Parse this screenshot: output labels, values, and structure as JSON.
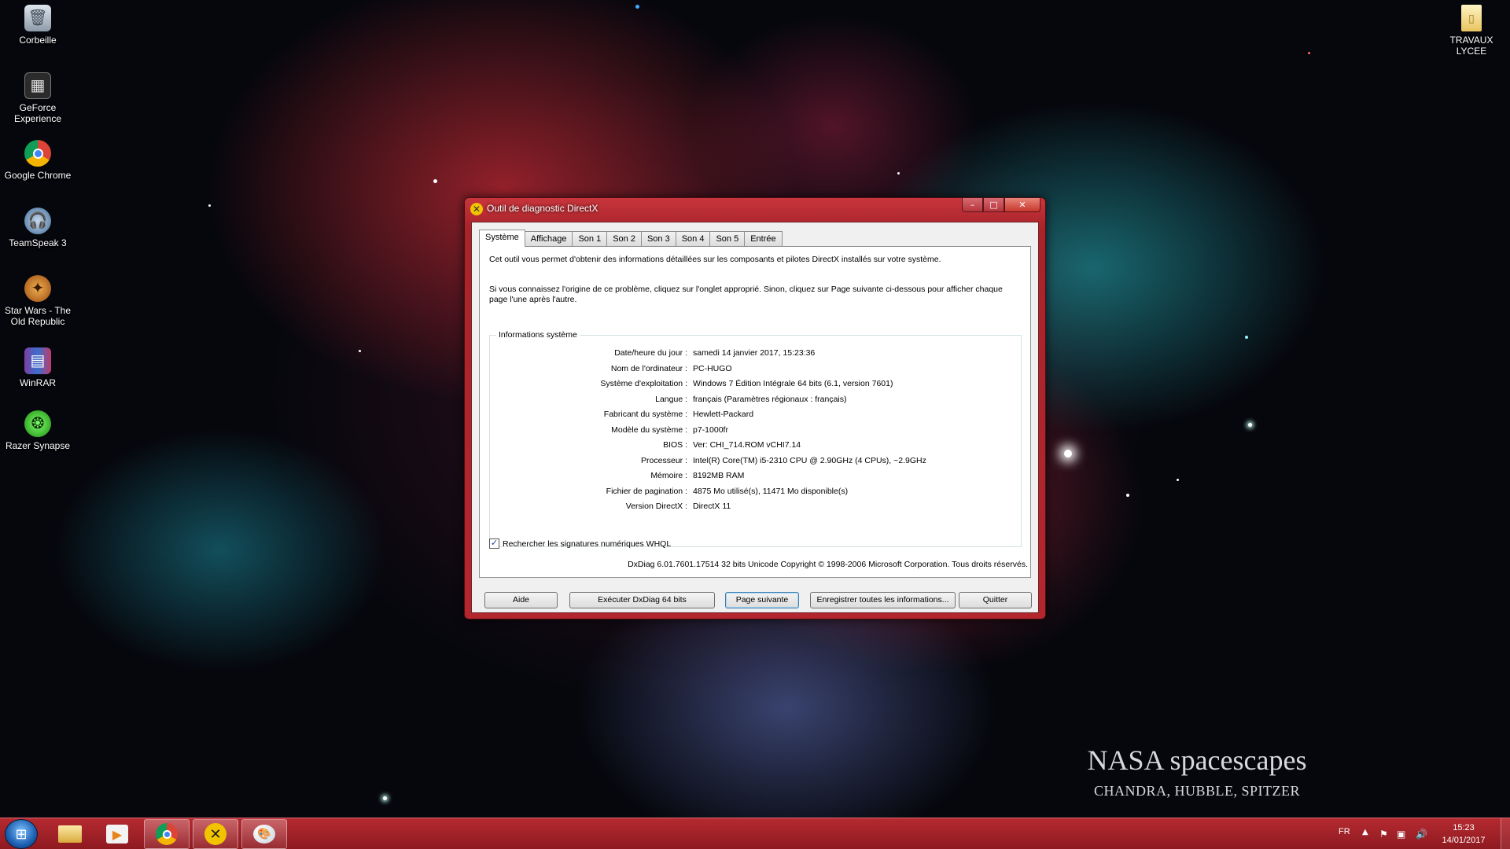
{
  "desktop": {
    "icons": [
      {
        "label": "Corbeille",
        "icon": "recycle-bin-icon"
      },
      {
        "label": "GeForce Experience",
        "icon": "geforce-icon"
      },
      {
        "label": "Google Chrome",
        "icon": "chrome-icon"
      },
      {
        "label": "TeamSpeak 3",
        "icon": "teamspeak-icon"
      },
      {
        "label": "Star Wars - The Old Republic",
        "icon": "swtor-icon"
      },
      {
        "label": "WinRAR",
        "icon": "winrar-icon"
      },
      {
        "label": "Razer Synapse",
        "icon": "razer-icon"
      }
    ],
    "right_icon": {
      "label": "TRAVAUX LYCEE",
      "icon": "folder-icon"
    },
    "watermark": {
      "title": "NASA spacescapes",
      "subtitle": "CHANDRA, HUBBLE, SPITZER"
    }
  },
  "window": {
    "title": "Outil de diagnostic DirectX",
    "controls": {
      "minimize": "–",
      "maximize": "□",
      "close": "✕"
    },
    "tabs": [
      {
        "label": "Système",
        "active": true
      },
      {
        "label": "Affichage"
      },
      {
        "label": "Son 1"
      },
      {
        "label": "Son 2"
      },
      {
        "label": "Son 3"
      },
      {
        "label": "Son 4"
      },
      {
        "label": "Son 5"
      },
      {
        "label": "Entrée"
      }
    ],
    "intro1": "Cet outil vous permet d'obtenir des informations détaillées sur les composants et pilotes DirectX installés sur votre système.",
    "intro2": "Si vous connaissez l'origine de ce problème, cliquez sur l'onglet approprié. Sinon, cliquez sur Page suivante ci-dessous pour afficher chaque page l'une après l'autre.",
    "group_title": "Informations système",
    "info": [
      {
        "label": "Date/heure du jour :",
        "value": "samedi 14 janvier 2017, 15:23:36"
      },
      {
        "label": "Nom de l'ordinateur :",
        "value": "PC-HUGO"
      },
      {
        "label": "Système d'exploitation :",
        "value": "Windows 7 Édition Intégrale 64 bits (6.1, version 7601)"
      },
      {
        "label": "Langue :",
        "value": "français (Paramètres régionaux : français)"
      },
      {
        "label": "Fabricant du système :",
        "value": "Hewlett-Packard"
      },
      {
        "label": "Modèle du système :",
        "value": "p7-1000fr"
      },
      {
        "label": "BIOS :",
        "value": "Ver: CHI_714.ROM vCHI7.14"
      },
      {
        "label": "Processeur :",
        "value": "Intel(R) Core(TM) i5-2310 CPU @ 2.90GHz (4 CPUs), ~2.9GHz"
      },
      {
        "label": "Mémoire :",
        "value": "8192MB RAM"
      },
      {
        "label": "Fichier de pagination :",
        "value": "4875 Mo utilisé(s), 11471 Mo disponible(s)"
      },
      {
        "label": "Version DirectX :",
        "value": "DirectX 11"
      }
    ],
    "checkbox": {
      "label": "Rechercher les signatures numériques WHQL",
      "checked": true,
      "mark": "✓"
    },
    "copyright": "DxDiag 6.01.7601.17514 32 bits Unicode Copyright © 1998-2006 Microsoft Corporation. Tous droits réservés.",
    "buttons": {
      "help": "Aide",
      "run64": "Exécuter DxDiag 64 bits",
      "next": "Page suivante",
      "save": "Enregistrer toutes les informations...",
      "quit": "Quitter"
    }
  },
  "taskbar": {
    "language": "FR",
    "time": "15:23",
    "date": "14/01/2017"
  },
  "colors": {
    "window_frame": "#b3262e",
    "taskbar": "#a42128",
    "default_button_border": "#3c7fb1"
  }
}
